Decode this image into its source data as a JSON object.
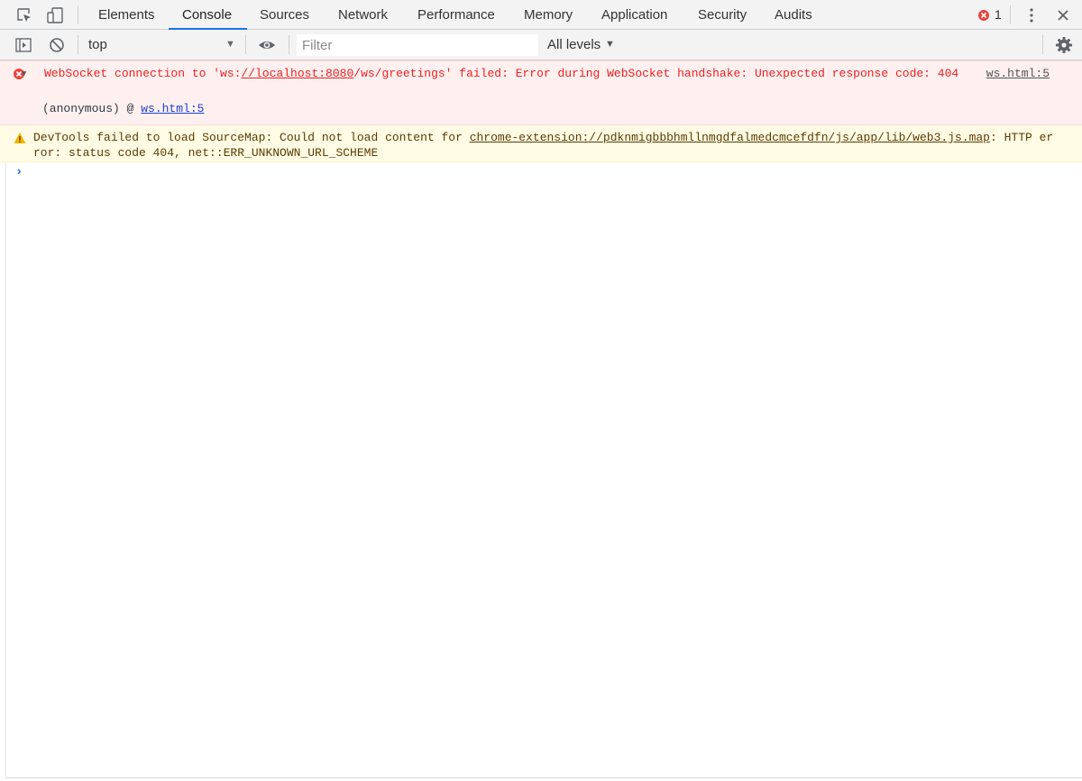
{
  "tabs": [
    {
      "label": "Elements"
    },
    {
      "label": "Console"
    },
    {
      "label": "Sources"
    },
    {
      "label": "Network"
    },
    {
      "label": "Performance"
    },
    {
      "label": "Memory"
    },
    {
      "label": "Application"
    },
    {
      "label": "Security"
    },
    {
      "label": "Audits"
    }
  ],
  "active_tab": "Console",
  "error_count": "1",
  "toolbar": {
    "context": "top",
    "filter_placeholder": "Filter",
    "levels": "All levels"
  },
  "messages": {
    "error": {
      "prefix": "WebSocket connection to 'ws:",
      "host": "//localhost:8080",
      "rest": "/ws/greetings' failed: Error during WebSocket handshake: Unexpected response code: 404",
      "source": "ws.html:5",
      "stack_fn": "(anonymous) @ ",
      "stack_link": "ws.html:5"
    },
    "warning": {
      "prefix": "DevTools failed to load SourceMap: Could not load content for ",
      "url": "chrome-extension://pdknmigbbbhmllnmgdfalmedcmcefdfn/js/app/lib/web3.js.map",
      "rest": ": HTTP error: status code 404, net::ERR_UNKNOWN_URL_SCHEME"
    }
  },
  "colors": {
    "accent": "#1a73e8",
    "error_text": "#f02020",
    "error_bg": "#fff0f0",
    "warning_text": "#5c3c00",
    "warning_bg": "#fffbe5"
  }
}
